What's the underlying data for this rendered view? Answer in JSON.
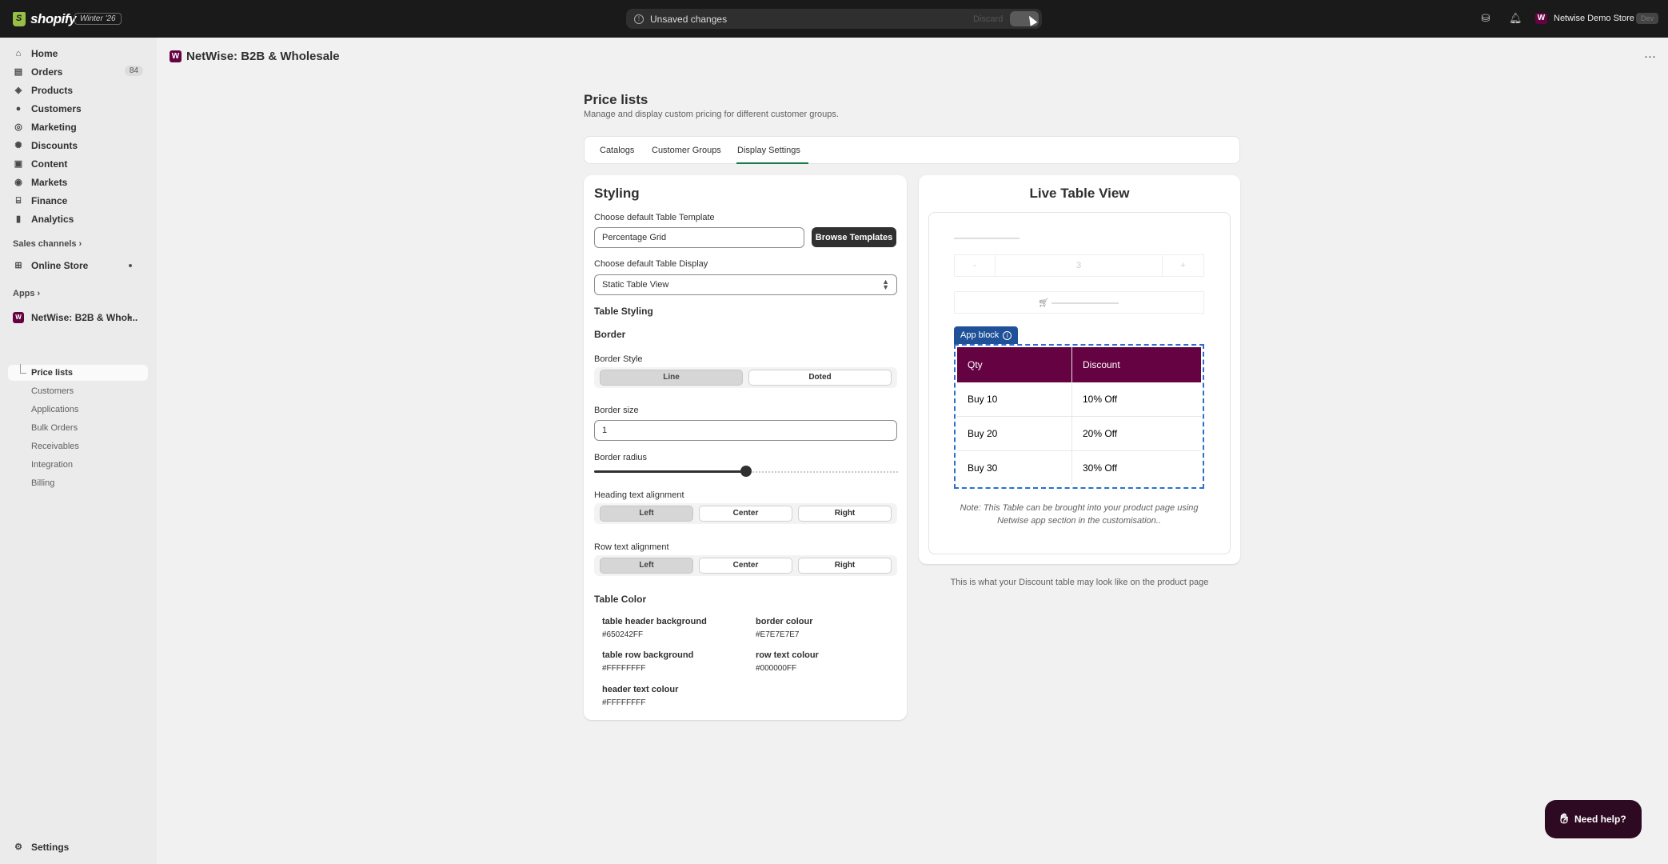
{
  "topbar": {
    "brand": "shopify",
    "edition_badge": "Winter '26",
    "unsaved_text": "Unsaved changes",
    "discard_label": "Discard",
    "store_name": "Netwise Demo Store",
    "store_badge": "Dev",
    "store_logo_letter": "W",
    "icons": [
      "info-icon",
      "store-icon",
      "bell-icon"
    ]
  },
  "sidebar": {
    "items": [
      {
        "label": "Home",
        "icon": "home-icon"
      },
      {
        "label": "Orders",
        "icon": "orders-icon",
        "count": "84"
      },
      {
        "label": "Products",
        "icon": "tag-icon"
      },
      {
        "label": "Customers",
        "icon": "person-icon"
      },
      {
        "label": "Marketing",
        "icon": "target-icon"
      },
      {
        "label": "Discounts",
        "icon": "discount-icon"
      },
      {
        "label": "Content",
        "icon": "content-icon"
      },
      {
        "label": "Markets",
        "icon": "globe-icon"
      },
      {
        "label": "Finance",
        "icon": "bank-icon"
      },
      {
        "label": "Analytics",
        "icon": "chart-icon"
      }
    ],
    "sales_channels_label": "Sales channels",
    "online_store_label": "Online Store",
    "apps_label": "Apps",
    "app_name": "NetWise: B2B & Whol...",
    "app_sub_items": [
      "Price lists",
      "Customers",
      "Applications",
      "Bulk Orders",
      "Receivables",
      "Integration",
      "Billing"
    ],
    "settings_label": "Settings"
  },
  "header": {
    "app_title": "NetWise: B2B & Wholesale",
    "app_logo_letter": "W"
  },
  "page": {
    "title": "Price lists",
    "subtitle": "Manage and display custom pricing for different customer groups.",
    "tabs": [
      "Catalogs",
      "Customer Groups",
      "Display Settings"
    ],
    "active_tab": "Display Settings"
  },
  "styling": {
    "heading": "Styling",
    "template_label": "Choose default Table Template",
    "template_value": "Percentage Grid",
    "browse_label": "Browse Templates",
    "display_label": "Choose default Table Display",
    "display_value": "Static Table View",
    "table_styling_heading": "Table Styling",
    "border_heading": "Border",
    "border_style_label": "Border Style",
    "border_style_options": [
      "Line",
      "Doted"
    ],
    "border_style_selected": "Line",
    "border_size_label": "Border size",
    "border_size_value": "1",
    "border_radius_label": "Border radius",
    "border_radius_fraction": 0.5,
    "heading_align_label": "Heading text alignment",
    "heading_align_options": [
      "Left",
      "Center",
      "Right"
    ],
    "heading_align_selected": "Left",
    "row_align_label": "Row text alignment",
    "row_align_options": [
      "Left",
      "Center",
      "Right"
    ],
    "row_align_selected": "Left",
    "table_color_heading": "Table Color",
    "colors": {
      "header_bg_label": "table header background",
      "header_bg_value": "#650242FF",
      "border_colour_label": "border colour",
      "border_colour_value": "#E7E7E7E7",
      "row_bg_label": "table row background",
      "row_bg_value": "#FFFFFFFF",
      "row_text_label": "row text colour",
      "row_text_value": "#000000FF",
      "header_text_label": "header text colour",
      "header_text_value": "#FFFFFFFF"
    }
  },
  "preview": {
    "heading": "Live Table View",
    "qty_minus": "-",
    "qty_value": "3",
    "qty_plus": "+",
    "app_block_label": "App block",
    "table_headers": [
      "Qty",
      "Discount"
    ],
    "table_rows": [
      [
        "Buy 10",
        "10% Off"
      ],
      [
        "Buy 20",
        "20% Off"
      ],
      [
        "Buy 30",
        "30% Off"
      ]
    ],
    "note": "Note: This Table can be brought into your product page using Netwise app section in the customisation..",
    "caption": "This is what your Discount table may look like on the product page"
  },
  "help": {
    "label": "Need help?"
  },
  "colors": {
    "accent": "#650242",
    "tab_underline": "#1a7a4a",
    "app_block": "#1f5199"
  }
}
